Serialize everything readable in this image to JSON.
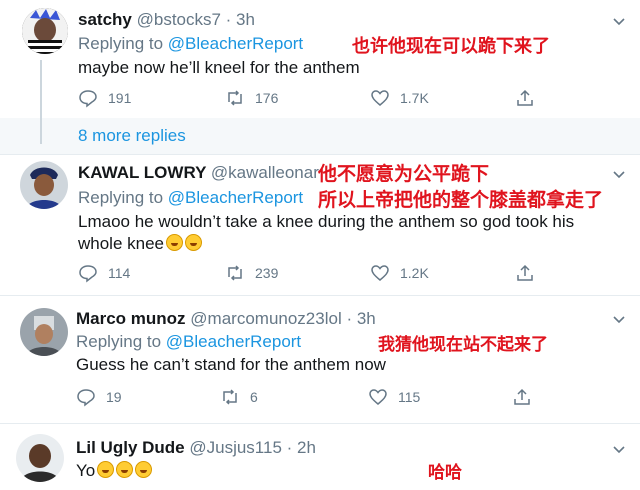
{
  "tweets": [
    {
      "name": "satchy",
      "handle": "@bstocks7 · 3h",
      "replying_prefix": "Replying to ",
      "replying_to": "@BleacherReport",
      "text": "maybe now he’ll kneel for the anthem",
      "note": "也许他现在可以跪下来了",
      "replies": "191",
      "retweets": "176",
      "likes": "1.7K"
    },
    {
      "name": "KAWAL LOWRY",
      "handle": "@kawalleonar",
      "replying_prefix": "Replying to ",
      "replying_to": "@BleacherReport",
      "text_line1": "Lmaoo he wouldn’t take a knee during the anthem so god took his",
      "text_line2": "whole knee",
      "note_line1": "他不愿意为公平跪下",
      "note_line2": "所以上帝把他的整个膝盖都拿走了",
      "replies": "114",
      "retweets": "239",
      "likes": "1.2K"
    },
    {
      "name": "Marco munoz",
      "handle": "@marcomunoz23lol · 3h",
      "replying_prefix": "Replying to ",
      "replying_to": "@BleacherReport",
      "text": "Guess he can’t stand for the anthem now",
      "note": "我猜他现在站不起来了",
      "replies": "19",
      "retweets": "6",
      "likes": "115"
    },
    {
      "name": "Lil Ugly Dude",
      "handle": "@Jusjus115 · 2h",
      "text": "Yo",
      "note": "哈哈"
    }
  ],
  "more_replies": "8 more replies",
  "icons": [
    "reply-icon",
    "retweet-icon",
    "like-icon",
    "share-icon",
    "chevron-down-icon"
  ],
  "colors": {
    "link": "#1b95e0",
    "muted": "#657786",
    "annotation": "#e0141e"
  }
}
